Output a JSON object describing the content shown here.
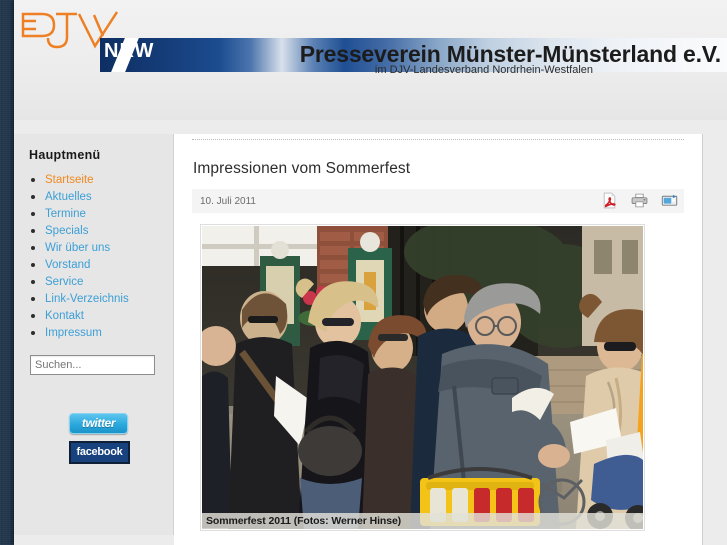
{
  "site": {
    "logo_alt": "DJV NRW",
    "banner_badge": "NRW",
    "banner_title": "Presseverein Münster-Münsterland e.V.",
    "banner_subtitle": "im DJV-Landesverband Nordrhein-Westfalen",
    "accent_orange": "#f28a21",
    "accent_blue": "#1b4e9b",
    "link_blue": "#3c9fd6"
  },
  "sidebar": {
    "heading": "Hauptmenü",
    "items": [
      {
        "label": "Startseite",
        "active": true
      },
      {
        "label": "Aktuelles",
        "active": false
      },
      {
        "label": "Termine",
        "active": false
      },
      {
        "label": "Specials",
        "active": false
      },
      {
        "label": "Wir über uns",
        "active": false
      },
      {
        "label": "Vorstand",
        "active": false
      },
      {
        "label": "Service",
        "active": false
      },
      {
        "label": "Link-Verzeichnis",
        "active": false
      },
      {
        "label": "Kontakt",
        "active": false
      },
      {
        "label": "Impressum",
        "active": false
      }
    ],
    "search": {
      "placeholder": "Suchen...",
      "value": ""
    },
    "social": {
      "twitter_label": "twitter",
      "facebook_label": "facebook"
    }
  },
  "article": {
    "title": "Impressionen vom Sommerfest",
    "date": "10. Juli 2011",
    "tools": [
      {
        "name": "pdf-icon",
        "label": "PDF"
      },
      {
        "name": "print-icon",
        "label": "Drucken"
      },
      {
        "name": "email-icon",
        "label": "E-Mail"
      }
    ],
    "figure": {
      "caption": "Sommerfest 2011 (Fotos: Werner Hinse)",
      "alt": "Besucher beim Sommerfest im Freien"
    }
  }
}
